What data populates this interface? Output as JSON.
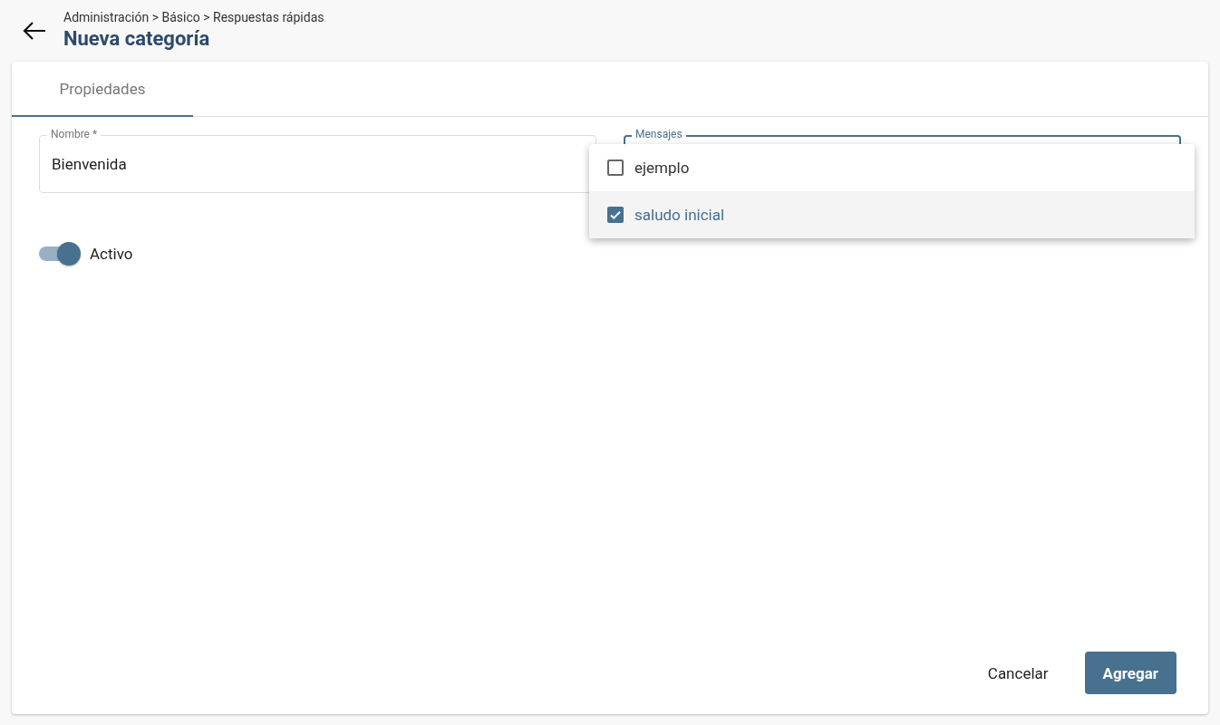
{
  "header": {
    "breadcrumb": "Administración > Básico > Respuestas rápidas",
    "title": "Nueva categoría"
  },
  "tabs": [
    {
      "label": "Propiedades",
      "selected": true
    }
  ],
  "fields": [
    {
      "label": "Nombre *",
      "value": "Bienvenida",
      "focused": false
    },
    {
      "label": "Mensajes",
      "focused": true
    }
  ],
  "toggle": {
    "label": "Activo",
    "on": true
  },
  "dropdown": {
    "options": [
      {
        "label": "ejemplo",
        "checked": false
      },
      {
        "label": "saludo inicial",
        "checked": true
      }
    ]
  },
  "buttons": [
    {
      "label": "Cancelar",
      "kind": "text"
    },
    {
      "label": "Agregar",
      "kind": "primary"
    }
  ]
}
